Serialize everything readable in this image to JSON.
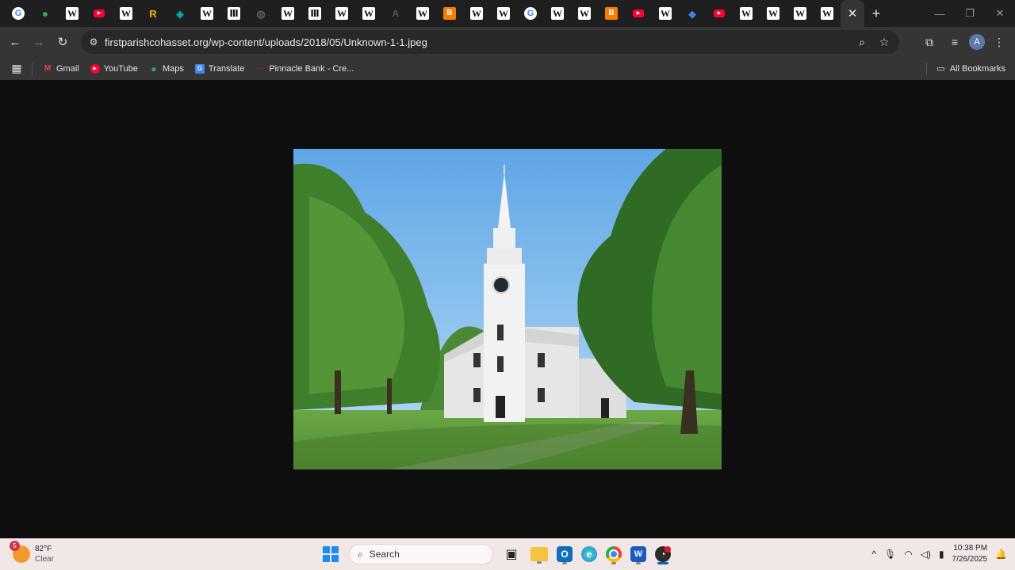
{
  "tabs": [
    {
      "icon": "google-icon",
      "glyph": "G",
      "cls": "g"
    },
    {
      "icon": "maps-pin-icon",
      "glyph": "●",
      "cls": "pin"
    },
    {
      "icon": "wikipedia-icon",
      "glyph": "W",
      "cls": "w"
    },
    {
      "icon": "youtube-icon",
      "glyph": "▶",
      "cls": "yt"
    },
    {
      "icon": "wikipedia-icon",
      "glyph": "W",
      "cls": "w"
    },
    {
      "icon": "r-icon",
      "glyph": "R",
      "cls": "r"
    },
    {
      "icon": "shield-icon",
      "glyph": "◆",
      "cls": "sh"
    },
    {
      "icon": "wikipedia-icon",
      "glyph": "W",
      "cls": "w"
    },
    {
      "icon": "museum-icon",
      "glyph": "Ⅲ",
      "cls": "mu"
    },
    {
      "icon": "globe-icon",
      "glyph": "◍",
      "cls": "gl"
    },
    {
      "icon": "wikipedia-icon",
      "glyph": "W",
      "cls": "w"
    },
    {
      "icon": "museum-icon",
      "glyph": "Ⅲ",
      "cls": "mu"
    },
    {
      "icon": "wikipedia-icon",
      "glyph": "W",
      "cls": "w"
    },
    {
      "icon": "wikipedia-icon",
      "glyph": "W",
      "cls": "w"
    },
    {
      "icon": "archive-icon",
      "glyph": "A",
      "cls": "ax"
    },
    {
      "icon": "wikipedia-icon",
      "glyph": "W",
      "cls": "w"
    },
    {
      "icon": "blogger-icon",
      "glyph": "B",
      "cls": "bl"
    },
    {
      "icon": "wikipedia-icon",
      "glyph": "W",
      "cls": "w"
    },
    {
      "icon": "wikipedia-icon",
      "glyph": "W",
      "cls": "w"
    },
    {
      "icon": "google-icon",
      "glyph": "G",
      "cls": "g"
    },
    {
      "icon": "wikipedia-icon",
      "glyph": "W",
      "cls": "w"
    },
    {
      "icon": "wikipedia-icon",
      "glyph": "W",
      "cls": "w"
    },
    {
      "icon": "blogger-icon",
      "glyph": "B",
      "cls": "bl"
    },
    {
      "icon": "youtube-icon",
      "glyph": "▶",
      "cls": "yt"
    },
    {
      "icon": "wikipedia-icon",
      "glyph": "W",
      "cls": "w"
    },
    {
      "icon": "bluesky-icon",
      "glyph": "◆",
      "cls": "bs"
    },
    {
      "icon": "youtube-icon",
      "glyph": "▶",
      "cls": "yt"
    },
    {
      "icon": "wikipedia-icon",
      "glyph": "W",
      "cls": "w"
    },
    {
      "icon": "wikipedia-icon",
      "glyph": "W",
      "cls": "w"
    },
    {
      "icon": "wikipedia-icon",
      "glyph": "W",
      "cls": "w"
    },
    {
      "icon": "wikipedia-icon",
      "glyph": "W",
      "cls": "w"
    }
  ],
  "active_tab": {
    "close_glyph": "✕"
  },
  "new_tab_glyph": "+",
  "window_controls": {
    "minimize": "—",
    "restore": "❐",
    "close": "✕"
  },
  "toolbar": {
    "back": "←",
    "forward": "→",
    "reload": "↻",
    "site_info": "⚙",
    "url": "firstparishcohasset.org/wp-content/uploads/2018/05/Unknown-1-1.jpeg",
    "zoom": "⌕",
    "bookmark_star": "☆",
    "tab_search": "⧉",
    "media": "≡",
    "profile": "A",
    "menu": "⋮"
  },
  "bookmarks": {
    "apps_glyph": "▦",
    "items": [
      {
        "label": "Gmail",
        "icon": "gmail-icon",
        "glyph": "M",
        "cls": "gm"
      },
      {
        "label": "YouTube",
        "icon": "youtube-icon",
        "glyph": "▶",
        "cls": "yt"
      },
      {
        "label": "Maps",
        "icon": "maps-icon",
        "glyph": "●",
        "cls": "mp"
      },
      {
        "label": "Translate",
        "icon": "translate-icon",
        "glyph": "G",
        "cls": "tr"
      },
      {
        "label": "Pinnacle Bank - Cre...",
        "icon": "pinnacle-bank-icon",
        "glyph": "—",
        "cls": "pb"
      }
    ],
    "all_bookmarks": "All Bookmarks",
    "folder_glyph": "▭"
  },
  "colors": {
    "sky": "#8cc3f0",
    "grass": "#5f9a3c",
    "tree": "#3c7a2a",
    "church": "#eeeeee"
  },
  "taskbar": {
    "weather": {
      "badge": "5",
      "temp": "82°F",
      "condition": "Clear"
    },
    "search_label": "Search",
    "search_glyph": "⌕",
    "apps": [
      {
        "name": "task-view",
        "glyph": "▣",
        "cls": "tv"
      },
      {
        "name": "file-explorer",
        "glyph": "",
        "cls": "fe"
      },
      {
        "name": "outlook",
        "glyph": "O",
        "cls": "ol"
      },
      {
        "name": "edge",
        "glyph": "e",
        "cls": "ed"
      },
      {
        "name": "chrome",
        "glyph": "",
        "cls": "ch"
      },
      {
        "name": "word",
        "glyph": "W",
        "cls": "wd"
      },
      {
        "name": "app",
        "glyph": "◔",
        "cls": "ap"
      }
    ],
    "tray": {
      "chevron": "^",
      "mic": "🎙",
      "wifi": "◠",
      "volume": "◁)",
      "battery": "▮",
      "time": "10:38 PM",
      "date": "7/26/2025",
      "notifications": "🔔"
    }
  }
}
